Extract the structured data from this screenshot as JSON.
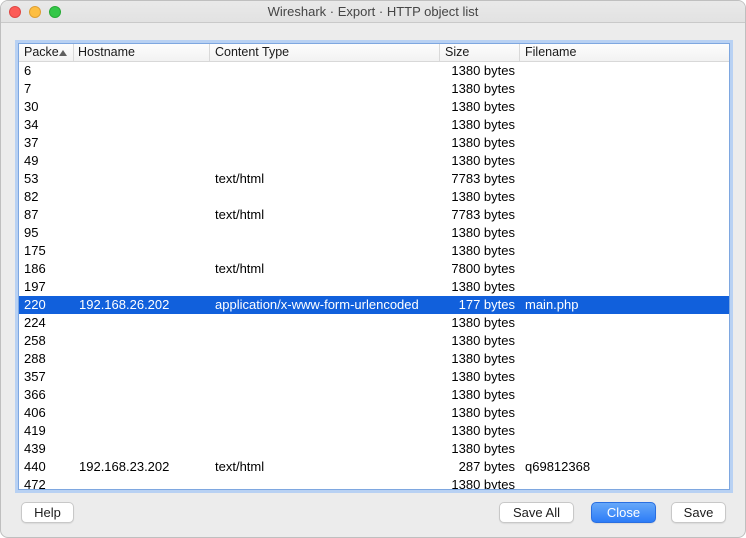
{
  "window": {
    "title": "Wireshark · Export · HTTP object list"
  },
  "table": {
    "columns": [
      {
        "key": "packet",
        "label": "Packe",
        "sort": "asc"
      },
      {
        "key": "hostname",
        "label": "Hostname"
      },
      {
        "key": "content_type",
        "label": "Content Type"
      },
      {
        "key": "size",
        "label": "Size"
      },
      {
        "key": "filename",
        "label": "Filename"
      }
    ],
    "rows": [
      {
        "packet": "6",
        "hostname": "",
        "content_type": "",
        "size": "1380 bytes",
        "filename": ""
      },
      {
        "packet": "7",
        "hostname": "",
        "content_type": "",
        "size": "1380 bytes",
        "filename": ""
      },
      {
        "packet": "30",
        "hostname": "",
        "content_type": "",
        "size": "1380 bytes",
        "filename": ""
      },
      {
        "packet": "34",
        "hostname": "",
        "content_type": "",
        "size": "1380 bytes",
        "filename": ""
      },
      {
        "packet": "37",
        "hostname": "",
        "content_type": "",
        "size": "1380 bytes",
        "filename": ""
      },
      {
        "packet": "49",
        "hostname": "",
        "content_type": "",
        "size": "1380 bytes",
        "filename": ""
      },
      {
        "packet": "53",
        "hostname": "",
        "content_type": "text/html",
        "size": "7783 bytes",
        "filename": ""
      },
      {
        "packet": "82",
        "hostname": "",
        "content_type": "",
        "size": "1380 bytes",
        "filename": ""
      },
      {
        "packet": "87",
        "hostname": "",
        "content_type": "text/html",
        "size": "7783 bytes",
        "filename": ""
      },
      {
        "packet": "95",
        "hostname": "",
        "content_type": "",
        "size": "1380 bytes",
        "filename": ""
      },
      {
        "packet": "175",
        "hostname": "",
        "content_type": "",
        "size": "1380 bytes",
        "filename": ""
      },
      {
        "packet": "186",
        "hostname": "",
        "content_type": "text/html",
        "size": "7800 bytes",
        "filename": ""
      },
      {
        "packet": "197",
        "hostname": "",
        "content_type": "",
        "size": "1380 bytes",
        "filename": ""
      },
      {
        "packet": "220",
        "hostname": "192.168.26.202",
        "content_type": "application/x-www-form-urlencoded",
        "size": "177 bytes",
        "filename": "main.php",
        "selected": true
      },
      {
        "packet": "224",
        "hostname": "",
        "content_type": "",
        "size": "1380 bytes",
        "filename": ""
      },
      {
        "packet": "258",
        "hostname": "",
        "content_type": "",
        "size": "1380 bytes",
        "filename": ""
      },
      {
        "packet": "288",
        "hostname": "",
        "content_type": "",
        "size": "1380 bytes",
        "filename": ""
      },
      {
        "packet": "357",
        "hostname": "",
        "content_type": "",
        "size": "1380 bytes",
        "filename": ""
      },
      {
        "packet": "366",
        "hostname": "",
        "content_type": "",
        "size": "1380 bytes",
        "filename": ""
      },
      {
        "packet": "406",
        "hostname": "",
        "content_type": "",
        "size": "1380 bytes",
        "filename": ""
      },
      {
        "packet": "419",
        "hostname": "",
        "content_type": "",
        "size": "1380 bytes",
        "filename": ""
      },
      {
        "packet": "439",
        "hostname": "",
        "content_type": "",
        "size": "1380 bytes",
        "filename": ""
      },
      {
        "packet": "440",
        "hostname": "192.168.23.202",
        "content_type": "text/html",
        "size": "287 bytes",
        "filename": "q69812368"
      },
      {
        "packet": "472",
        "hostname": "",
        "content_type": "",
        "size": "1380 bytes",
        "filename": "",
        "partial": true
      }
    ],
    "selected_packet": "220"
  },
  "footer": {
    "help": "Help",
    "save_all": "Save All",
    "close": "Close",
    "save": "Save"
  },
  "colors": {
    "selection": "#1160dc",
    "button_blue_top": "#66a8f9",
    "button_blue_bottom": "#2c7cf7",
    "focus_ring": "#b8d1f3",
    "traffic_red": "#fc5b57",
    "traffic_yellow": "#fdbe41",
    "traffic_green": "#34c748"
  }
}
